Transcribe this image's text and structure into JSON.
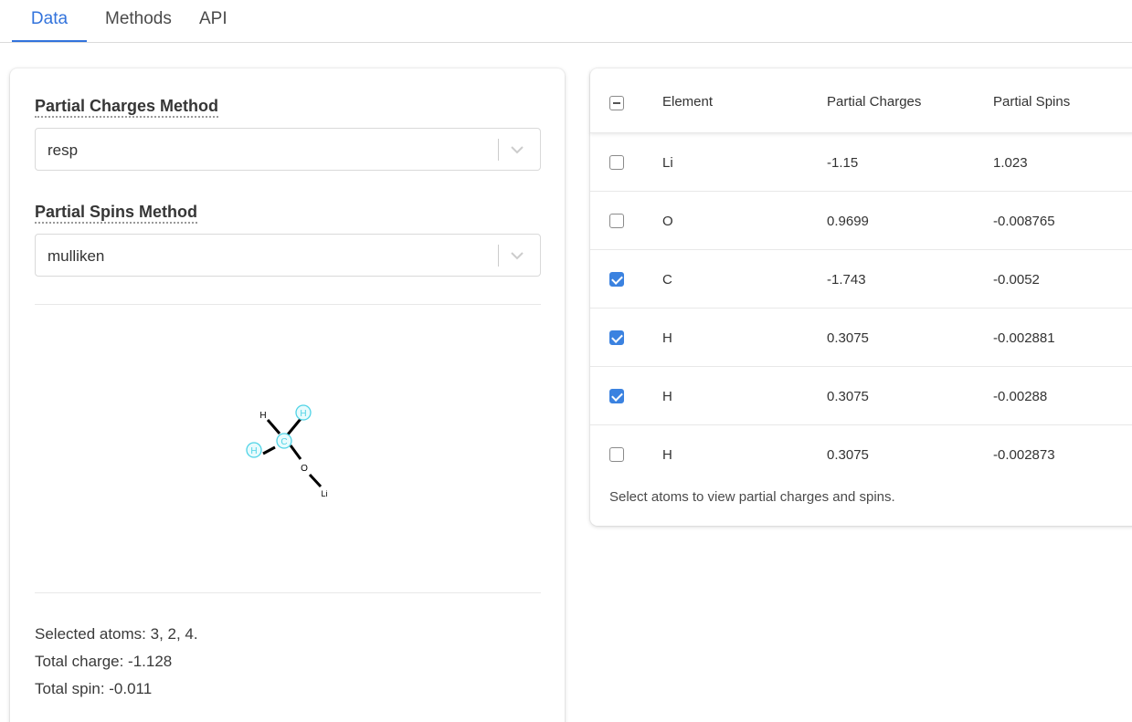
{
  "tabs": [
    {
      "label": "Data",
      "active": true
    },
    {
      "label": "Methods",
      "active": false
    },
    {
      "label": "API",
      "active": false
    }
  ],
  "controls": {
    "charges_label": "Partial Charges Method",
    "charges_value": "resp",
    "spins_label": "Partial Spins Method",
    "spins_value": "mulliken"
  },
  "molecule": {
    "atoms": [
      {
        "symbol": "H",
        "highlighted": false
      },
      {
        "symbol": "H",
        "highlighted": true
      },
      {
        "symbol": "C",
        "highlighted": true
      },
      {
        "symbol": "H",
        "highlighted": true
      },
      {
        "symbol": "O",
        "highlighted": false
      },
      {
        "symbol": "Li",
        "highlighted": false
      }
    ],
    "highlight_color": "#4fd3e6"
  },
  "summary": {
    "selected": "Selected atoms: 3, 2, 4.",
    "charge": "Total charge: -1.128",
    "spin": "Total spin: -0.011"
  },
  "table": {
    "headers": [
      "Element",
      "Partial Charges",
      "Partial Spins"
    ],
    "rows": [
      {
        "checked": false,
        "element": "Li",
        "charge": "-1.15",
        "spin": "1.023"
      },
      {
        "checked": false,
        "element": "O",
        "charge": "0.9699",
        "spin": "-0.008765"
      },
      {
        "checked": true,
        "element": "C",
        "charge": "-1.743",
        "spin": "-0.0052"
      },
      {
        "checked": true,
        "element": "H",
        "charge": "0.3075",
        "spin": "-0.002881"
      },
      {
        "checked": true,
        "element": "H",
        "charge": "0.3075",
        "spin": "-0.00288"
      },
      {
        "checked": false,
        "element": "H",
        "charge": "0.3075",
        "spin": "-0.002873"
      }
    ],
    "note": "Select atoms to view partial charges and spins."
  },
  "colors": {
    "accent": "#3273dc",
    "checkbox": "#3b82e0"
  }
}
